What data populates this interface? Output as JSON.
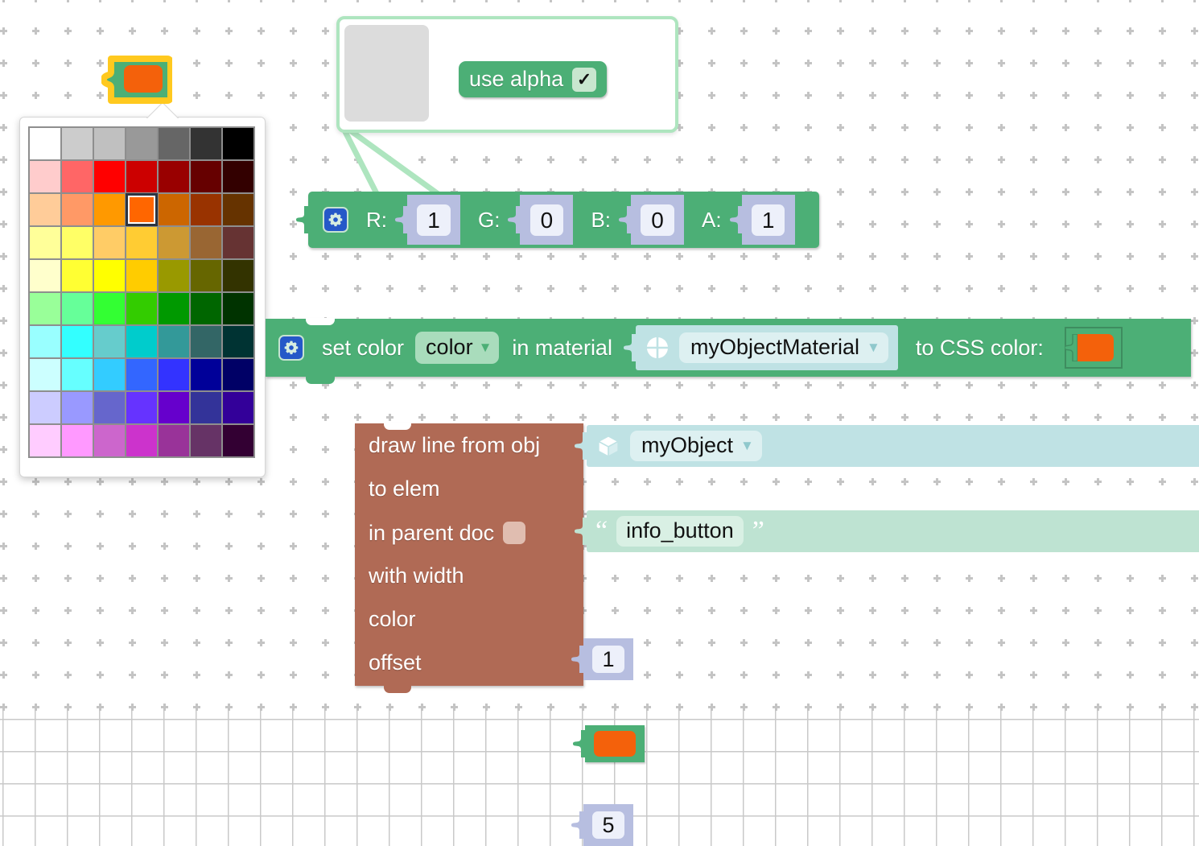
{
  "workspace": {
    "background_color": "#ffffff",
    "grid_mark_color": "#c4c4c4",
    "grid_spacing": 40
  },
  "selected_color_block": {
    "name": "colour-value-block",
    "swatch_color": "#F4610B",
    "block_color": "#4CAF76",
    "highlight_color": "#FFC91F",
    "selected": true
  },
  "color_picker": {
    "name": "colour-picker-popup",
    "columns": 7,
    "rows": 10,
    "selected_index": 17,
    "selected_color": "#F4610B",
    "colors": [
      "#FFFFFF",
      "#CCCCCC",
      "#C0C0C0",
      "#999999",
      "#666666",
      "#333333",
      "#000000",
      "#FFCCCC",
      "#FF6666",
      "#FF0000",
      "#CC0000",
      "#990000",
      "#660000",
      "#330000",
      "#FFCC99",
      "#FF9966",
      "#FF9900",
      "#FF6600",
      "#CC6600",
      "#993300",
      "#663300",
      "#FFFF99",
      "#FFFF66",
      "#FFCC66",
      "#FFCC33",
      "#CC9933",
      "#996633",
      "#663333",
      "#FFFFCC",
      "#FFFF33",
      "#FFFF00",
      "#FFCC00",
      "#999900",
      "#666600",
      "#333300",
      "#99FF99",
      "#66FF99",
      "#33FF33",
      "#33CC00",
      "#009900",
      "#006600",
      "#003300",
      "#99FFFF",
      "#33FFFF",
      "#66CCCC",
      "#00CCCC",
      "#339999",
      "#336666",
      "#003333",
      "#CCFFFF",
      "#66FFFF",
      "#33CCFF",
      "#3366FF",
      "#3333FF",
      "#000099",
      "#000066",
      "#CCCCFF",
      "#9999FF",
      "#6666CC",
      "#6633FF",
      "#6600CC",
      "#333399",
      "#330099",
      "#FFCCFF",
      "#FF99FF",
      "#CC66CC",
      "#CC33CC",
      "#993399",
      "#663366",
      "#330033"
    ]
  },
  "mutator_bubble": {
    "name": "mutator-bubble",
    "border_color": "#AEE5BF",
    "use_alpha": {
      "label": "use alpha",
      "checked": true,
      "check_glyph": "✓"
    }
  },
  "rgba_block": {
    "name": "rgba-colour-block",
    "block_color": "#4CAF76",
    "gear_icon": "gear-icon",
    "channels": [
      {
        "label": "R:",
        "value": "1"
      },
      {
        "label": "G:",
        "value": "0"
      },
      {
        "label": "B:",
        "value": "0"
      },
      {
        "label": "A:",
        "value": "1"
      }
    ]
  },
  "set_color_block": {
    "name": "set-colour-in-material-block",
    "block_color": "#4CAF76",
    "gear_icon": "gear-icon",
    "text_1": "set color",
    "property_dropdown": "color",
    "text_2": "in material",
    "material_icon": "material-sphere-icon",
    "material_dropdown": "myObjectMaterial",
    "text_3": "to CSS color:",
    "css_color_value": "#F4610B",
    "caret_glyph": "▼"
  },
  "draw_line_block": {
    "name": "draw-line-block",
    "block_color": "#B06A55",
    "rows": [
      {
        "label": "draw line from obj",
        "kind": "object"
      },
      {
        "label": "to elem",
        "kind": "string"
      },
      {
        "label": "in parent doc",
        "kind": "doc-field"
      },
      {
        "label": "with width",
        "kind": "number"
      },
      {
        "label": "color",
        "kind": "colour"
      },
      {
        "label": "offset",
        "kind": "number"
      }
    ],
    "object_icon": "cube-icon",
    "object_value": "myObject",
    "object_caret": "▼",
    "string_open_quote": "“",
    "string_value": "info_button",
    "string_close_quote": "”",
    "width_value": "1",
    "colour_value": "#F4610B",
    "offset_value": "5"
  }
}
